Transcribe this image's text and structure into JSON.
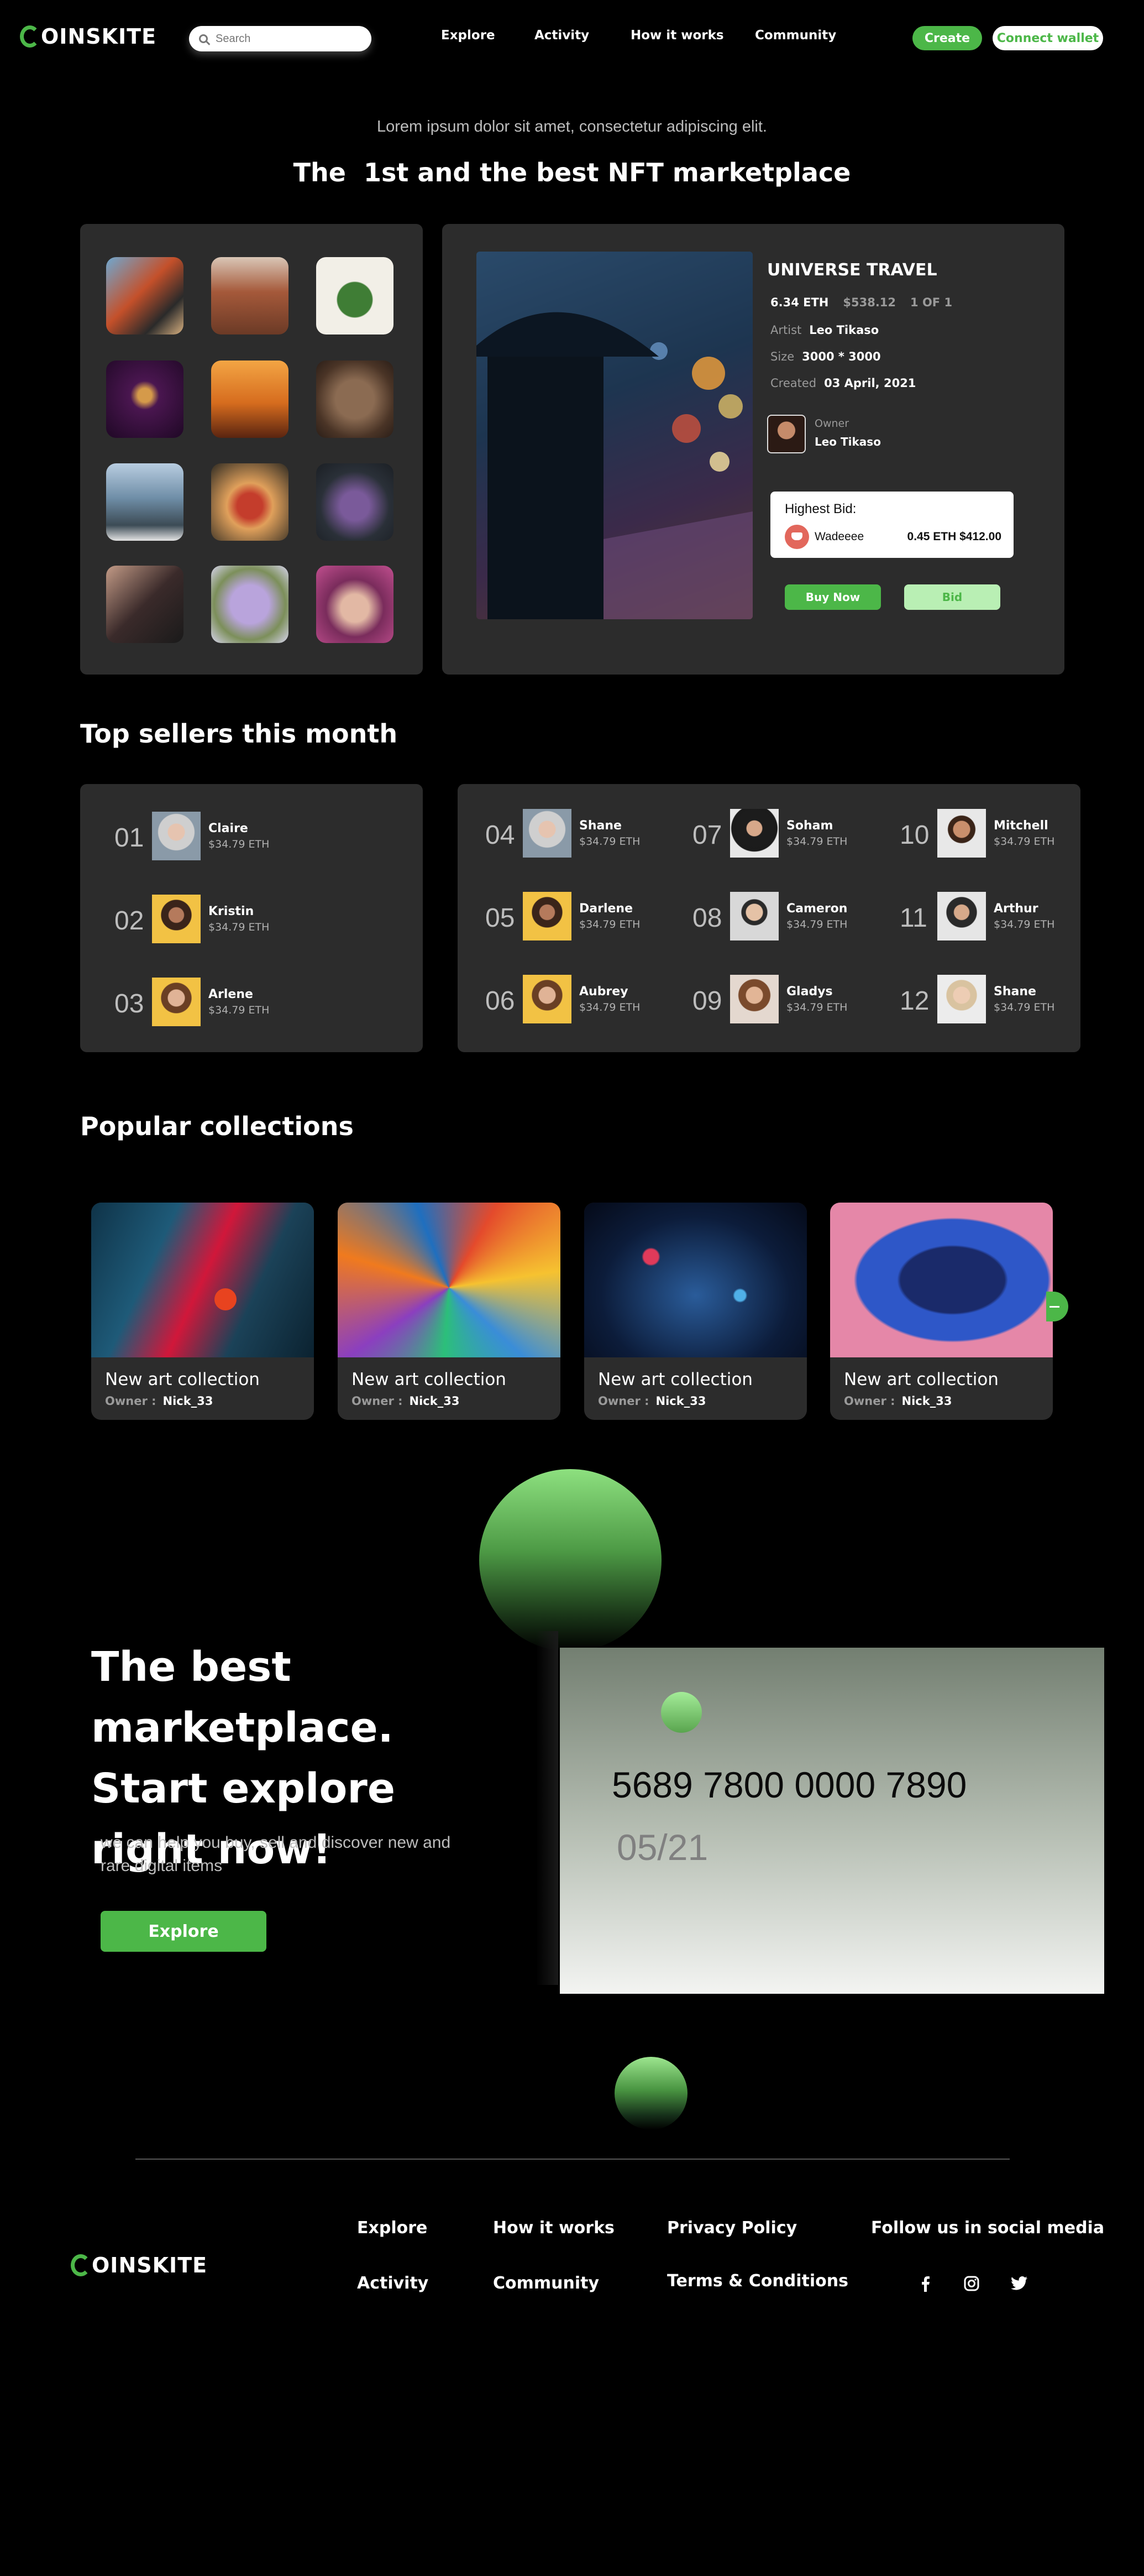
{
  "brand": {
    "name": "OINSKITE"
  },
  "nav": {
    "search_placeholder": "Search",
    "links": [
      "Explore",
      "Activity",
      "How it works",
      "Community"
    ],
    "create": "Create",
    "connect": "Connect wallet"
  },
  "hero": {
    "subtitle": "Lorem ipsum dolor sit amet, consectetur adipiscing elit.",
    "title": "The  1st and the best NFT marketplace"
  },
  "featured": {
    "title": "UNIVERSE TRAVEL",
    "price_eth": "6.34 ETH",
    "price_usd": "$538.12",
    "edition": "1 OF 1",
    "artist_label": "Artist",
    "artist": "Leo Tikaso",
    "size_label": "Size",
    "size": "3000 * 3000",
    "created_label": "Created",
    "created": "03 April, 2021",
    "owner_label": "Owner",
    "owner": "Leo Tikaso",
    "highest_bid_label": "Highest Bid:",
    "bidder": "Wadeeee",
    "bid_amount": "0.45 ETH $412.00",
    "buy_now": "Buy Now",
    "bid": "Bid"
  },
  "sellers": {
    "title": "Top sellers this month",
    "list": [
      {
        "rank": "01",
        "name": "Claire",
        "amount": "$34.79 ETH"
      },
      {
        "rank": "02",
        "name": "Kristin",
        "amount": "$34.79 ETH"
      },
      {
        "rank": "03",
        "name": "Arlene",
        "amount": "$34.79 ETH"
      },
      {
        "rank": "04",
        "name": "Shane",
        "amount": "$34.79 ETH"
      },
      {
        "rank": "05",
        "name": "Darlene",
        "amount": "$34.79 ETH"
      },
      {
        "rank": "06",
        "name": "Aubrey",
        "amount": "$34.79 ETH"
      },
      {
        "rank": "07",
        "name": "Soham",
        "amount": "$34.79 ETH"
      },
      {
        "rank": "08",
        "name": "Cameron",
        "amount": "$34.79 ETH"
      },
      {
        "rank": "09",
        "name": "Gladys",
        "amount": "$34.79 ETH"
      },
      {
        "rank": "10",
        "name": "Mitchell",
        "amount": "$34.79 ETH"
      },
      {
        "rank": "11",
        "name": "Arthur",
        "amount": "$34.79 ETH"
      },
      {
        "rank": "12",
        "name": "Shane",
        "amount": "$34.79 ETH"
      }
    ]
  },
  "collections": {
    "title": "Popular collections",
    "cards": [
      {
        "title": "New art collection",
        "owner_label": "Owner :",
        "owner": "Nick_33"
      },
      {
        "title": "New art collection",
        "owner_label": "Owner :",
        "owner": "Nick_33"
      },
      {
        "title": "New art collection",
        "owner_label": "Owner :",
        "owner": "Nick_33"
      },
      {
        "title": "New art collection",
        "owner_label": "Owner :",
        "owner": "Nick_33"
      }
    ]
  },
  "cta": {
    "title": "The best marketplace. Start explore right now!",
    "subtitle": "we can help you buy, sell and discover new and rare digital items",
    "button": "Explore",
    "card_number": "5689 7800 0000 7890",
    "card_expiry": "05/21"
  },
  "footer": {
    "col1": [
      "Explore",
      "Activity"
    ],
    "col2": [
      "How it works",
      "Community"
    ],
    "col3": [
      "Privacy Policy",
      "Terms & Conditions"
    ],
    "social_title": "Follow us in social media",
    "social_icons": [
      "facebook-icon",
      "instagram-icon",
      "twitter-icon"
    ]
  },
  "colors": {
    "accent": "#4cb748",
    "panel": "#2c2c2c",
    "background": "#000000"
  }
}
